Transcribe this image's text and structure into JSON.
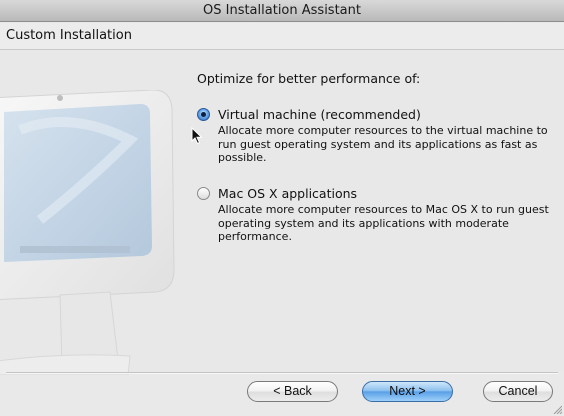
{
  "window": {
    "title": "OS Installation Assistant"
  },
  "header": {
    "title": "Custom Installation"
  },
  "main": {
    "prompt": "Optimize for better performance of:",
    "options": [
      {
        "label": "Virtual machine (recommended)",
        "description": "Allocate more computer resources to the virtual machine to run guest operating system and its applications as fast as possible.",
        "selected": true
      },
      {
        "label": "Mac OS X applications",
        "description": "Allocate more computer resources to Mac OS X to run guest operating system and its applications with moderate performance.",
        "selected": false
      }
    ]
  },
  "footer": {
    "back_label": "< Back",
    "next_label": "Next >",
    "cancel_label": "Cancel"
  },
  "icons": {
    "illustration": "imac-illustration-icon",
    "cursor": "arrow-cursor-icon",
    "resize": "resize-grip-icon"
  },
  "colors": {
    "primary_button": "#6aa8ea",
    "window_background": "#e8e8e8"
  }
}
